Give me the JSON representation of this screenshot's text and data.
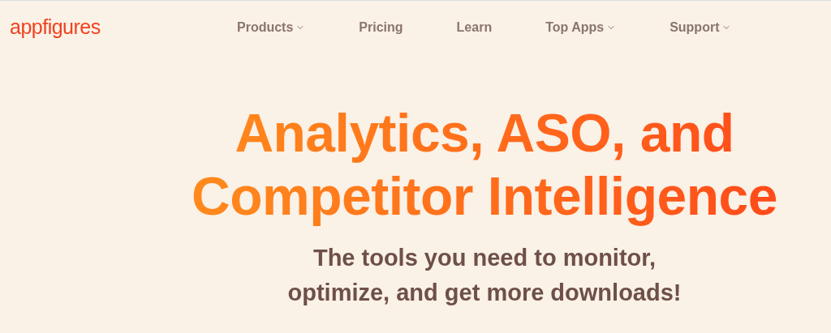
{
  "logo": "appfigures",
  "nav": [
    {
      "label": "Products",
      "dropdown": true
    },
    {
      "label": "Pricing",
      "dropdown": false
    },
    {
      "label": "Learn",
      "dropdown": false
    },
    {
      "label": "Top Apps",
      "dropdown": true
    },
    {
      "label": "Support",
      "dropdown": true
    }
  ],
  "hero": {
    "headline_lines": [
      "Analytics, ASO, and",
      "Competitor Intelligence"
    ],
    "subtitle_lines": [
      "The tools you need to monitor,",
      "optimize, and get more downloads!"
    ]
  }
}
